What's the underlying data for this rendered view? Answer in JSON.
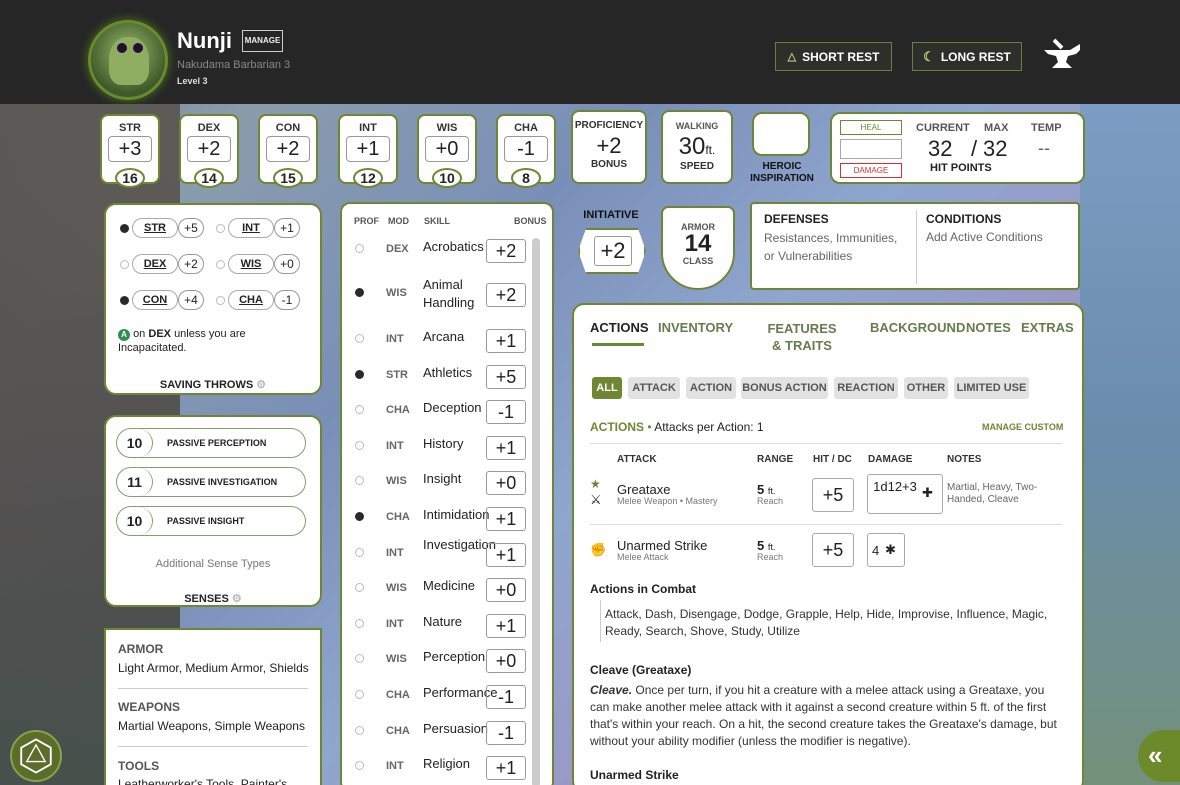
{
  "header": {
    "name": "Nunji",
    "manage": "MANAGE",
    "race_class": "Nakudama  Barbarian 3",
    "level": "Level 3",
    "short_rest": "SHORT REST",
    "long_rest": "LONG REST"
  },
  "abilities": [
    {
      "label": "STR",
      "mod": "+3",
      "score": "16"
    },
    {
      "label": "DEX",
      "mod": "+2",
      "score": "14"
    },
    {
      "label": "CON",
      "mod": "+2",
      "score": "15"
    },
    {
      "label": "INT",
      "mod": "+1",
      "score": "12"
    },
    {
      "label": "WIS",
      "mod": "+0",
      "score": "10"
    },
    {
      "label": "CHA",
      "mod": "-1",
      "score": "8"
    }
  ],
  "proficiency": {
    "title": "PROFICIENCY",
    "value": "+2",
    "sub": "BONUS"
  },
  "speed": {
    "title": "WALKING",
    "value": "30",
    "unit": "ft.",
    "sub": "SPEED"
  },
  "inspiration": {
    "label": "HEROIC INSPIRATION"
  },
  "hp": {
    "heal": "HEAL",
    "damage": "DAMAGE",
    "current_label": "CURRENT",
    "max_label": "MAX",
    "temp_label": "TEMP",
    "current": "32",
    "max": "32",
    "slash": "/",
    "temp": "--",
    "title": "HIT POINTS"
  },
  "initiative": {
    "label": "INITIATIVE",
    "value": "+2"
  },
  "armor": {
    "top": "ARMOR",
    "value": "14",
    "bottom": "CLASS"
  },
  "defenses": {
    "title": "DEFENSES",
    "text": "Resistances, Immunities, or Vulnerabilities"
  },
  "conditions": {
    "title": "CONDITIONS",
    "text": "Add Active Conditions"
  },
  "saving_throws": {
    "rows": [
      {
        "a": "STR",
        "av": "+5",
        "b": "INT",
        "bv": "+1"
      },
      {
        "a": "DEX",
        "av": "+2",
        "b": "WIS",
        "bv": "+0"
      },
      {
        "a": "CON",
        "av": "+4",
        "b": "CHA",
        "bv": "-1"
      }
    ],
    "note_prefix": "on",
    "note_dex": "DEX",
    "note_rest": "unless you are Incapacitated.",
    "title": "SAVING THROWS"
  },
  "senses": {
    "rows": [
      {
        "value": "10",
        "label": "PASSIVE PERCEPTION"
      },
      {
        "value": "11",
        "label": "PASSIVE INVESTIGATION"
      },
      {
        "value": "10",
        "label": "PASSIVE INSIGHT"
      }
    ],
    "additional": "Additional Sense Types",
    "title": "SENSES"
  },
  "proficiencies": {
    "armor_title": "ARMOR",
    "armor": "Light Armor, Medium Armor, Shields",
    "weapons_title": "WEAPONS",
    "weapons": "Martial Weapons, Simple Weapons",
    "tools_title": "TOOLS",
    "tools": "Leatherworker's Tools, Painter's"
  },
  "skills": {
    "headers": {
      "prof": "PROF",
      "mod": "MOD",
      "skill": "SKILL",
      "bonus": "BONUS"
    },
    "rows": [
      {
        "mod": "DEX",
        "name": "Acrobatics",
        "bonus": "+2",
        "prof": false
      },
      {
        "mod": "WIS",
        "name": "Animal Handling",
        "bonus": "+2",
        "prof": true
      },
      {
        "mod": "INT",
        "name": "Arcana",
        "bonus": "+1",
        "prof": false
      },
      {
        "mod": "STR",
        "name": "Athletics",
        "bonus": "+5",
        "prof": true
      },
      {
        "mod": "CHA",
        "name": "Deception",
        "bonus": "-1",
        "prof": false
      },
      {
        "mod": "INT",
        "name": "History",
        "bonus": "+1",
        "prof": false
      },
      {
        "mod": "WIS",
        "name": "Insight",
        "bonus": "+0",
        "prof": false
      },
      {
        "mod": "CHA",
        "name": "Intimidation",
        "bonus": "+1",
        "prof": true
      },
      {
        "mod": "INT",
        "name": "Investigation",
        "bonus": "+1",
        "prof": false
      },
      {
        "mod": "WIS",
        "name": "Medicine",
        "bonus": "+0",
        "prof": false
      },
      {
        "mod": "INT",
        "name": "Nature",
        "bonus": "+1",
        "prof": false
      },
      {
        "mod": "WIS",
        "name": "Perception",
        "bonus": "+0",
        "prof": false
      },
      {
        "mod": "CHA",
        "name": "Performance",
        "bonus": "-1",
        "prof": false
      },
      {
        "mod": "CHA",
        "name": "Persuasion",
        "bonus": "-1",
        "prof": false
      },
      {
        "mod": "INT",
        "name": "Religion",
        "bonus": "+1",
        "prof": false
      }
    ]
  },
  "tabs": [
    "ACTIONS",
    "INVENTORY",
    "FEATURES & TRAITS",
    "BACKGROUND",
    "NOTES",
    "EXTRAS"
  ],
  "filters": [
    "ALL",
    "ATTACK",
    "ACTION",
    "BONUS ACTION",
    "REACTION",
    "OTHER",
    "LIMITED USE"
  ],
  "actions": {
    "heading": "ACTIONS",
    "per_action": "Attacks per Action: 1",
    "manage_custom": "MANAGE CUSTOM",
    "table_headers": {
      "attack": "ATTACK",
      "range": "RANGE",
      "hit": "HIT / DC",
      "damage": "DAMAGE",
      "notes": "NOTES"
    },
    "attacks": [
      {
        "name": "Greataxe",
        "sub": "Melee Weapon • Mastery",
        "range": "5",
        "range_unit": "ft.",
        "range_sub": "Reach",
        "hit": "+5",
        "damage": "1d12+3",
        "notes": "Martial, Heavy, Two-Handed, Cleave"
      },
      {
        "name": "Unarmed Strike",
        "sub": "Melee Attack",
        "range": "5",
        "range_unit": "ft.",
        "range_sub": "Reach",
        "hit": "+5",
        "damage": "4",
        "notes": ""
      }
    ],
    "combat_title": "Actions in Combat",
    "combat_list": "Attack, Dash, Disengage, Dodge, Grapple, Help, Hide, Improvise, Influence, Magic, Ready, Search, Shove, Study, Utilize",
    "cleave_title": "Cleave (Greataxe)",
    "cleave_bold": "Cleave.",
    "cleave_text": "Once per turn, if you hit a creature with a melee attack using a Greataxe, you can make another melee attack with it against a second creature within 5 ft. of the first that's within your reach. On a hit, the second creature takes the Greataxe's damage, but without your ability modifier (unless the modifier is negative).",
    "unarmed_title": "Unarmed Strike"
  },
  "colors": {
    "accent": "#6f8732",
    "header": "#262626",
    "tab_active": "#222222"
  }
}
